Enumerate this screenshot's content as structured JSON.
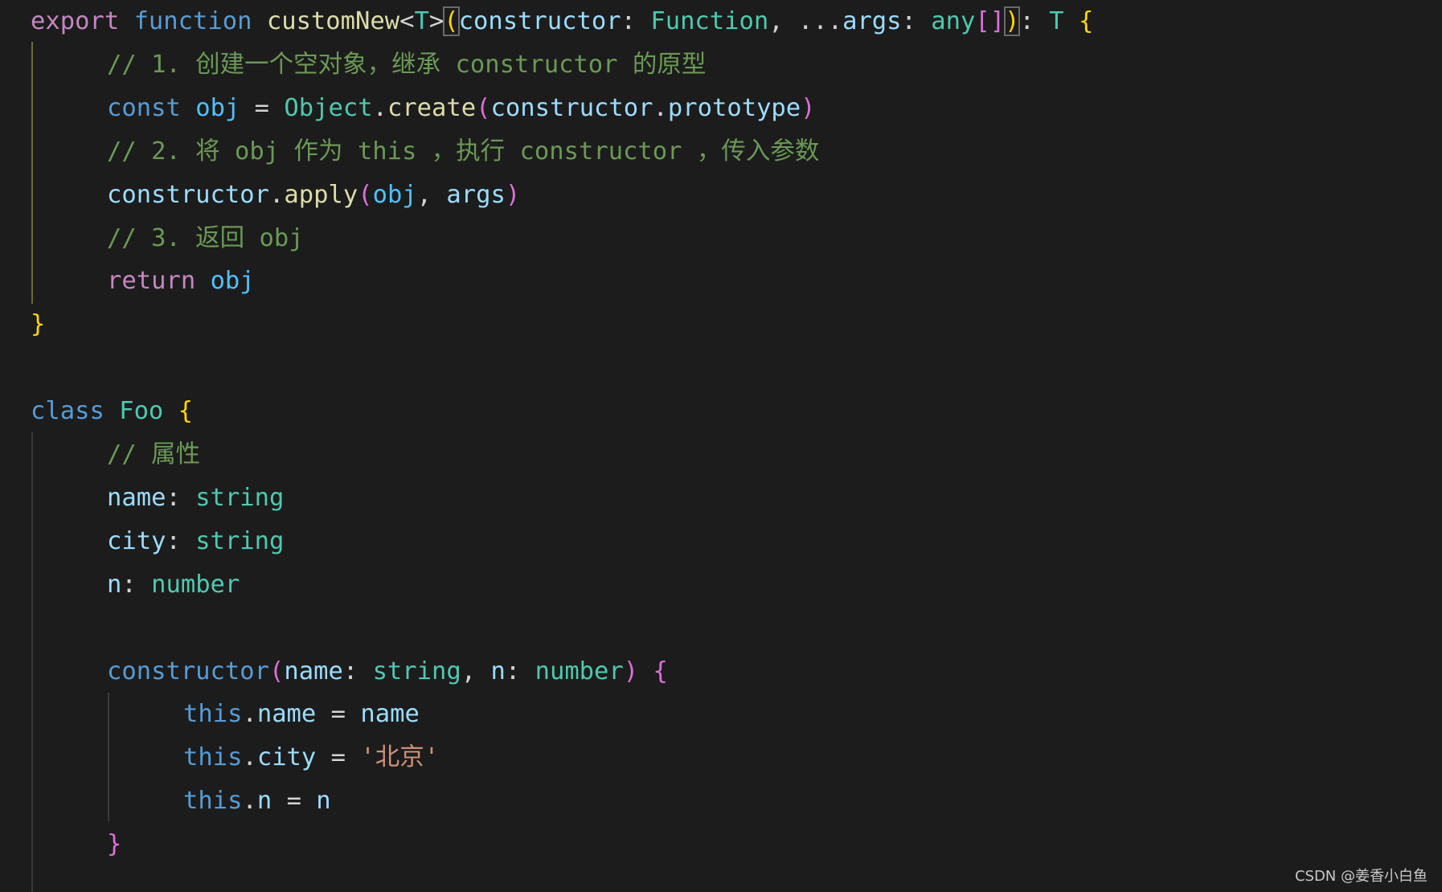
{
  "colors": {
    "background": "#1c1c1c",
    "keyword": "#c586c0",
    "storage": "#569cd6",
    "function": "#dcdcaa",
    "type": "#4ec9b0",
    "comment": "#6a9955",
    "variable": "#9cdcfe",
    "string": "#ce9178"
  },
  "code": [
    {
      "indent": 0,
      "tokens": [
        [
          "export",
          "kw"
        ],
        [
          " ",
          "tx"
        ],
        [
          "function",
          "st"
        ],
        [
          " ",
          "tx"
        ],
        [
          "customNew",
          "fn"
        ],
        [
          "<",
          "tx"
        ],
        [
          "T",
          "ty"
        ],
        [
          ">",
          "tx"
        ],
        [
          "(",
          "by box"
        ],
        [
          "constructor",
          "va"
        ],
        [
          ": ",
          "tx"
        ],
        [
          "Function",
          "ty"
        ],
        [
          ", ",
          "tx"
        ],
        [
          "...",
          "tx"
        ],
        [
          "args",
          "va"
        ],
        [
          ": ",
          "tx"
        ],
        [
          "any",
          "ty"
        ],
        [
          "[]",
          "bp"
        ],
        [
          ")",
          "by box"
        ],
        [
          ": ",
          "tx"
        ],
        [
          "T",
          "ty"
        ],
        [
          " ",
          "tx"
        ],
        [
          "{",
          "by"
        ]
      ]
    },
    {
      "indent": 1,
      "tokens": [
        [
          "// 1. 创建一个空对象，继承 constructor 的原型",
          "cm"
        ]
      ]
    },
    {
      "indent": 1,
      "tokens": [
        [
          "const",
          "st"
        ],
        [
          " ",
          "tx"
        ],
        [
          "obj",
          "ob"
        ],
        [
          " = ",
          "tx"
        ],
        [
          "Object",
          "ty"
        ],
        [
          ".",
          "tx"
        ],
        [
          "create",
          "fn"
        ],
        [
          "(",
          "bp"
        ],
        [
          "constructor",
          "va"
        ],
        [
          ".",
          "tx"
        ],
        [
          "prototype",
          "va"
        ],
        [
          ")",
          "bp"
        ]
      ]
    },
    {
      "indent": 1,
      "tokens": [
        [
          "// 2. 将 obj 作为 this ，执行 constructor ，传入参数",
          "cm"
        ]
      ]
    },
    {
      "indent": 1,
      "tokens": [
        [
          "constructor",
          "va"
        ],
        [
          ".",
          "tx"
        ],
        [
          "apply",
          "fn"
        ],
        [
          "(",
          "bp"
        ],
        [
          "obj",
          "ob"
        ],
        [
          ", ",
          "tx"
        ],
        [
          "args",
          "va"
        ],
        [
          ")",
          "bp"
        ]
      ]
    },
    {
      "indent": 1,
      "tokens": [
        [
          "// 3. 返回 obj",
          "cm"
        ]
      ]
    },
    {
      "indent": 1,
      "tokens": [
        [
          "return",
          "kw"
        ],
        [
          " ",
          "tx"
        ],
        [
          "obj",
          "ob"
        ]
      ]
    },
    {
      "indent": 0,
      "tokens": [
        [
          "}",
          "by"
        ]
      ]
    },
    {
      "indent": 0,
      "tokens": []
    },
    {
      "indent": 0,
      "tokens": [
        [
          "class",
          "st"
        ],
        [
          " ",
          "tx"
        ],
        [
          "Foo",
          "ty"
        ],
        [
          " ",
          "tx"
        ],
        [
          "{",
          "by"
        ]
      ]
    },
    {
      "indent": 1,
      "tokens": [
        [
          "// 属性",
          "cm"
        ]
      ]
    },
    {
      "indent": 1,
      "tokens": [
        [
          "name",
          "va"
        ],
        [
          ": ",
          "tx"
        ],
        [
          "string",
          "ty"
        ]
      ]
    },
    {
      "indent": 1,
      "tokens": [
        [
          "city",
          "va"
        ],
        [
          ": ",
          "tx"
        ],
        [
          "string",
          "ty"
        ]
      ]
    },
    {
      "indent": 1,
      "tokens": [
        [
          "n",
          "va"
        ],
        [
          ": ",
          "tx"
        ],
        [
          "number",
          "ty"
        ]
      ]
    },
    {
      "indent": 0,
      "tokens": []
    },
    {
      "indent": 1,
      "tokens": [
        [
          "constructor",
          "st"
        ],
        [
          "(",
          "bp"
        ],
        [
          "name",
          "va"
        ],
        [
          ": ",
          "tx"
        ],
        [
          "string",
          "ty"
        ],
        [
          ", ",
          "tx"
        ],
        [
          "n",
          "va"
        ],
        [
          ": ",
          "tx"
        ],
        [
          "number",
          "ty"
        ],
        [
          ")",
          "bp"
        ],
        [
          " ",
          "tx"
        ],
        [
          "{",
          "bp"
        ]
      ]
    },
    {
      "indent": 2,
      "tokens": [
        [
          "this",
          "st"
        ],
        [
          ".",
          "tx"
        ],
        [
          "name",
          "va"
        ],
        [
          " = ",
          "tx"
        ],
        [
          "name",
          "va"
        ]
      ]
    },
    {
      "indent": 2,
      "tokens": [
        [
          "this",
          "st"
        ],
        [
          ".",
          "tx"
        ],
        [
          "city",
          "va"
        ],
        [
          " = ",
          "tx"
        ],
        [
          "'北京'",
          "str"
        ]
      ]
    },
    {
      "indent": 2,
      "tokens": [
        [
          "this",
          "st"
        ],
        [
          ".",
          "tx"
        ],
        [
          "n",
          "va"
        ],
        [
          " = ",
          "tx"
        ],
        [
          "n",
          "va"
        ]
      ]
    },
    {
      "indent": 1,
      "tokens": [
        [
          "}",
          "bp"
        ]
      ]
    }
  ],
  "watermark": "CSDN @姜香小白鱼"
}
